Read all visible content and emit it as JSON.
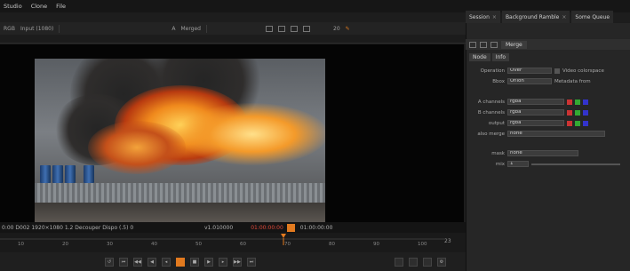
{
  "menu": [
    "Studio",
    "Clone",
    "File"
  ],
  "tabs": [
    {
      "label": "Session"
    },
    {
      "label": "Background Ramble"
    },
    {
      "label": "Some Queue"
    }
  ],
  "toolbar": {
    "left": "RGB",
    "source": "Input (1080)",
    "channel": "A",
    "mode": "Merged",
    "frame_field": "20"
  },
  "status": {
    "left": "0:00  D002  1920×1080  1.2 Decouper Dispo  (.5)   0.00",
    "mid": "v1.010000",
    "timecode": "01:00:00:00",
    "time2": "01:00:00:00"
  },
  "timeline": {
    "ticks": [
      "10",
      "20",
      "30",
      "40",
      "50",
      "60",
      "70",
      "80",
      "90",
      "100"
    ],
    "end_label": "23"
  },
  "panel": {
    "title": "Merge",
    "subtabs": [
      "Node",
      "Info"
    ],
    "rows": [
      {
        "label": "Operation",
        "value": "Over",
        "extra": "Video colorspace"
      },
      {
        "label": "Bbox",
        "value": "Union",
        "extra": "Metadata from"
      },
      {
        "label": "A channels",
        "value": "rgba"
      },
      {
        "label": "B channels",
        "value": "rgba"
      },
      {
        "label": "output",
        "value": "rgba"
      },
      {
        "label": "also merge",
        "value": "none"
      },
      {
        "label": "mask",
        "value": "none"
      },
      {
        "label": "mix",
        "value": "1"
      }
    ]
  },
  "colors": {
    "accent": "#e27a1f",
    "background": "#1d1d1d"
  }
}
